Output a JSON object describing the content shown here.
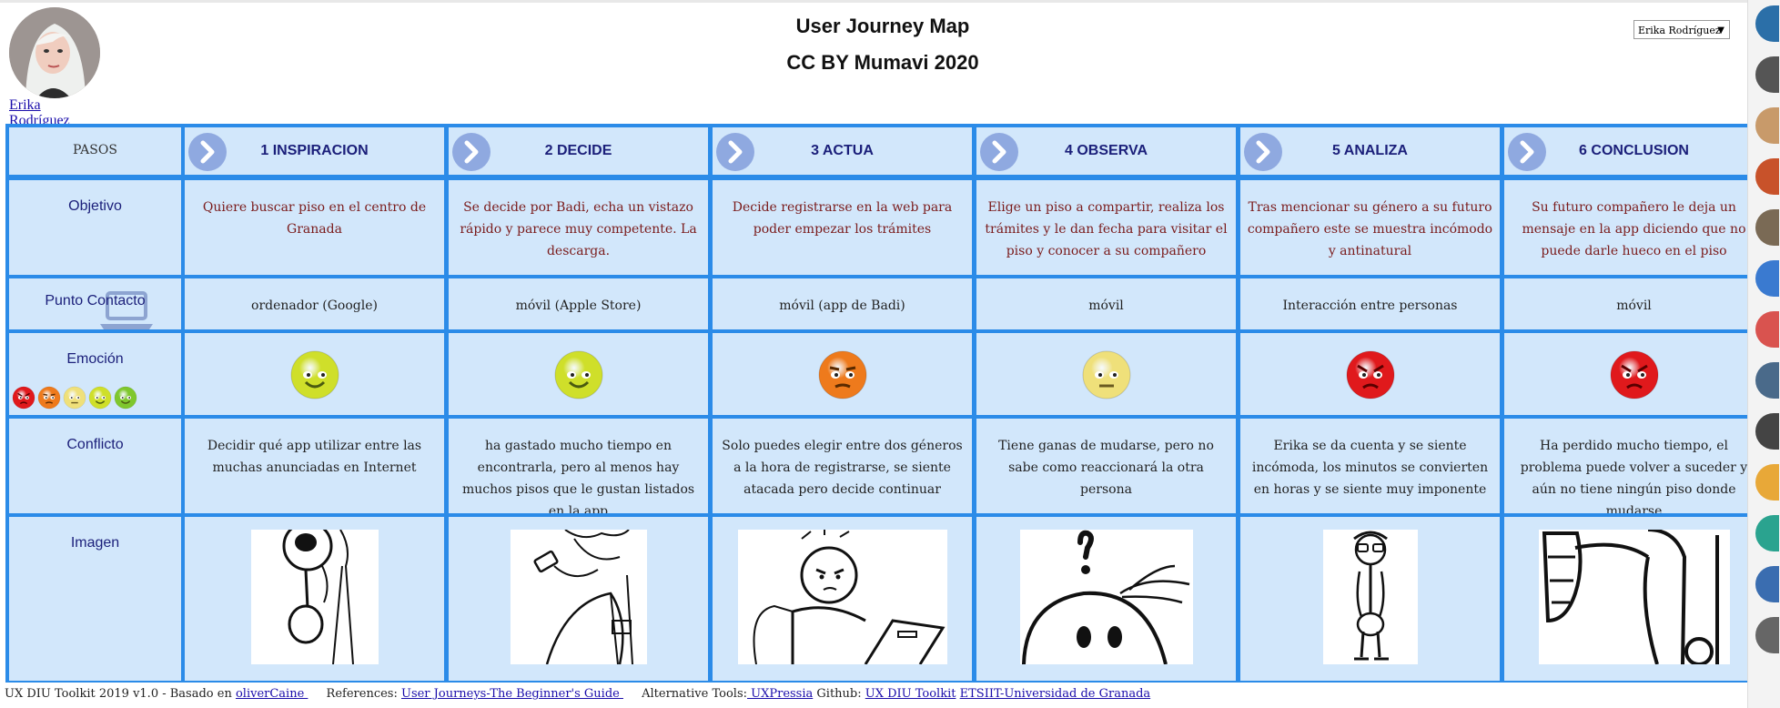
{
  "header": {
    "title": "User Journey Map",
    "subtitle": "CC BY Mumavi 2020",
    "avatar_first": "Erika",
    "avatar_last": "Rodríguez",
    "user_select": "Erika Rodríguez"
  },
  "labels": {
    "pasos": "PASOS",
    "objetivo": "Objetivo",
    "punto": "Punto Contacto",
    "emocion": "Emoción",
    "conflicto": "Conflicto",
    "imagen": "Imagen"
  },
  "steps": [
    {
      "name": "1 INSPIRACION",
      "objetivo": "Quiere buscar piso en el centro de Granada",
      "punto": "ordenador (Google)",
      "emotion": "happy",
      "conflicto": "Decidir qué app utilizar entre las muchas anunciadas en Internet",
      "image": "magnifier-figure"
    },
    {
      "name": "2 DECIDE",
      "objetivo": "Se decide por Badi, echa un vistazo rápido y parece muy competente. La descarga.",
      "punto": "móvil (Apple Store)",
      "emotion": "happy",
      "conflicto": "ha gastado mucho tiempo en encontrarla, pero al menos hay muchos pisos que le gustan listados en la app",
      "image": "phone-figure"
    },
    {
      "name": "3 ACTUA",
      "objetivo": "Decide registrarse en la web para poder empezar los trámites",
      "punto": "móvil (app de Badi)",
      "emotion": "annoyed",
      "conflicto": "Solo puedes elegir entre dos géneros a la hora de registrarse, se siente atacada pero decide continuar",
      "image": "angry-laptop-figure"
    },
    {
      "name": "4 OBSERVA",
      "objetivo": "Elige un piso a compartir, realiza los trámites y le dan fecha para visitar el piso y conocer a su compañero",
      "punto": "móvil",
      "emotion": "neutral",
      "conflicto": "Tiene ganas de mudarse, pero no sabe como reaccionará la otra persona",
      "image": "question-face"
    },
    {
      "name": "5 ANALIZA",
      "objetivo": "Tras mencionar su género a su futuro compañero este se muestra incómodo y antinatural",
      "punto": "Interacción entre personas",
      "emotion": "angry",
      "conflicto": "Erika se da cuenta y se siente incómoda, los minutos se convierten en horas y se siente muy imponente",
      "image": "standing-figure"
    },
    {
      "name": "6 CONCLUSION",
      "objetivo": "Su futuro compañero le deja un mensaje en la app diciendo que no puede darle hueco en el piso",
      "punto": "móvil",
      "emotion": "angry",
      "conflicto": "Ha perdido mucho tiempo, el problema puede volver a suceder y aún no tiene ningún piso donde mudarse",
      "image": "thumbs-down"
    }
  ],
  "emotion_legend": [
    "angry",
    "annoyed",
    "neutral",
    "happy",
    "very-happy"
  ],
  "emotion_colors": {
    "angry": "#e0191c",
    "annoyed": "#ee7a1c",
    "neutral": "#efe07a",
    "happy": "#cfdf2a",
    "very-happy": "#7fc72d"
  },
  "footer": {
    "text1": "UX DIU Toolkit 2019 v1.0 - Basado en ",
    "link1": "oliverCaine ",
    "text2": "References: ",
    "link2": "User Journeys-The Beginner's Guide ",
    "text3": "Alternative Tools:",
    "link3": " UXPressia",
    "text4": " Github: ",
    "link4": "UX DIU Toolkit",
    "link5": "ETSIIT-Universidad de Granada"
  },
  "colors": {
    "grid": "#2b8be8",
    "cell": "#d2e7fb",
    "heading": "#1b1f7a",
    "objective_text": "#7a1b1b"
  }
}
